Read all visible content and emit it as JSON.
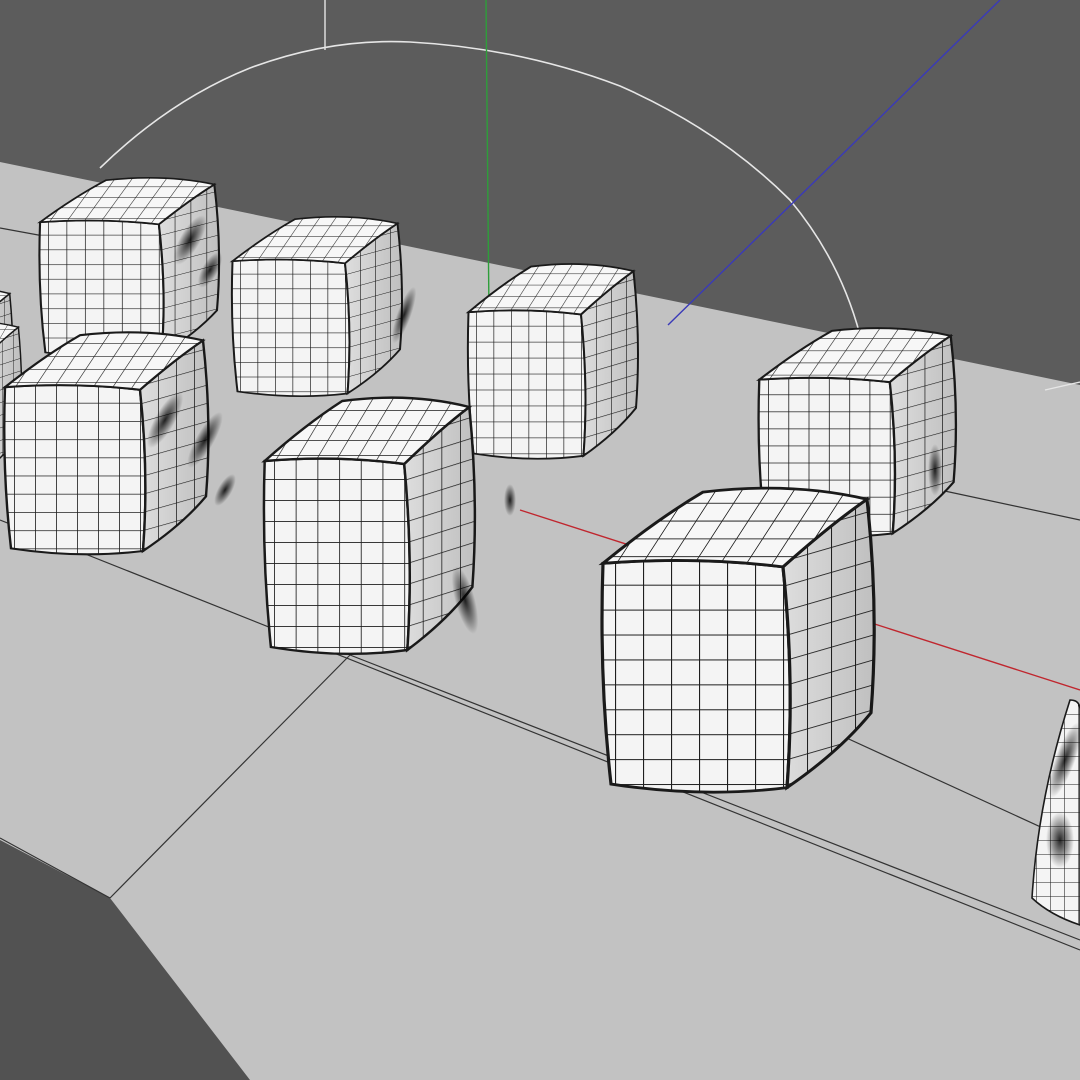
{
  "viewport": {
    "view": "perspective",
    "background_color": "#5c5c5c",
    "floor_color": "#c2c2c2",
    "floor_shadow_color": "#525252",
    "axis_colors": {
      "x": "#c0262e",
      "y": "#2e9e3a",
      "z": "#3a3ab8"
    },
    "grid_line_color": "#333333",
    "bounding_circle_color": "#e6e6e6",
    "object": {
      "name": "deformed-cube",
      "display": "smooth-shaded-with-wireframe",
      "mesh_color": "#f4f4f4",
      "wire_color": "#1e1e1e",
      "instance_count": 10
    }
  }
}
